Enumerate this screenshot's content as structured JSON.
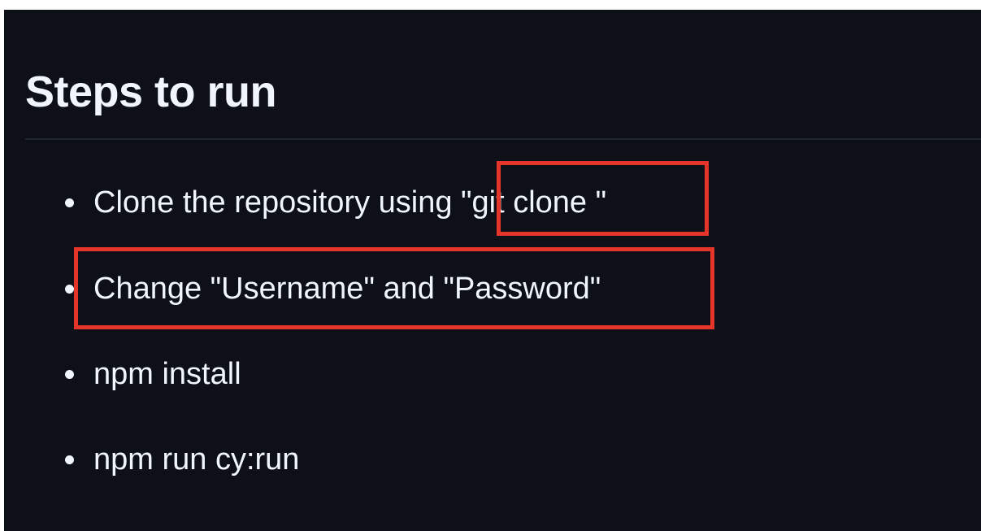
{
  "section": {
    "heading": "Steps to run"
  },
  "steps": [
    {
      "text": "Clone the repository using \"git clone \""
    },
    {
      "text": "Change \"Username\" and \"Password\""
    },
    {
      "text": "npm install"
    },
    {
      "text": "npm run cy:run"
    }
  ],
  "colors": {
    "background": "#0d1117",
    "text": "#f0f6fc",
    "divider": "#21262d",
    "annotation": "#e5352b"
  }
}
